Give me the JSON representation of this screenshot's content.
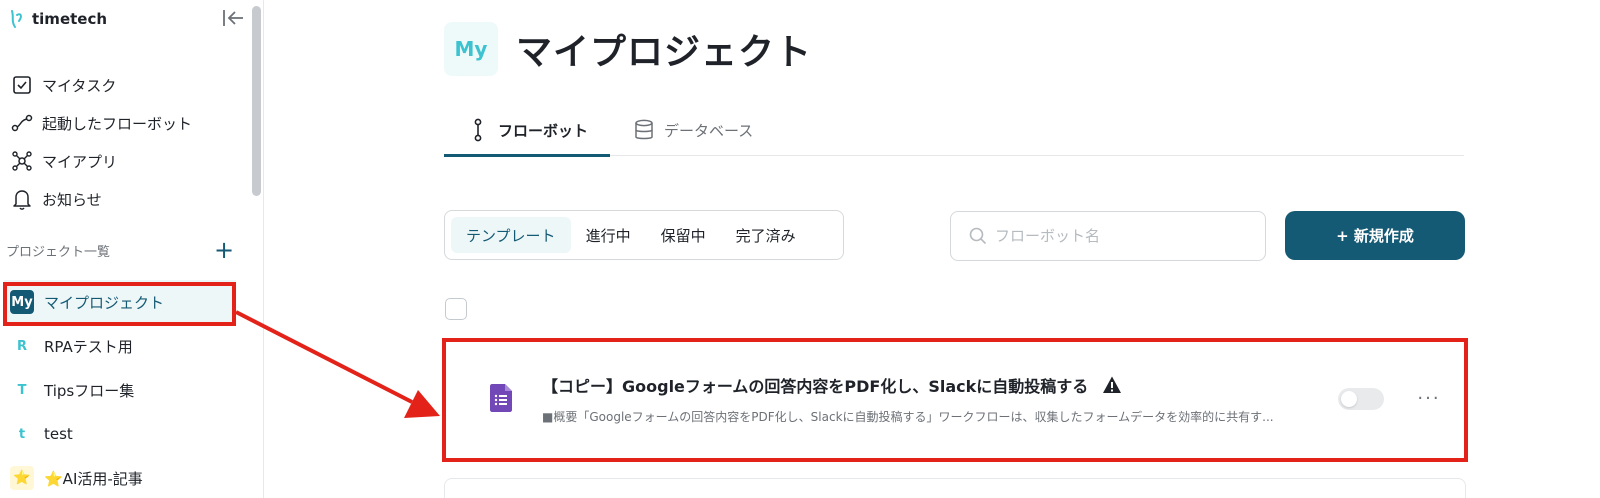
{
  "sidebar": {
    "brand": "timetech",
    "nav": [
      {
        "label": "マイタスク",
        "icon": "check-square-icon"
      },
      {
        "label": "起動したフローボット",
        "icon": "flow-path-icon"
      },
      {
        "label": "マイアプリ",
        "icon": "app-network-icon"
      },
      {
        "label": "お知らせ",
        "icon": "bell-icon"
      }
    ],
    "projects_header": "プロジェクト一覧",
    "projects_add": "+",
    "projects": [
      {
        "badge": "My",
        "label": "マイプロジェクト",
        "active": true
      },
      {
        "badge": "R",
        "label": "RPAテスト用"
      },
      {
        "badge": "T",
        "label": "Tipsフロー集"
      },
      {
        "badge": "t",
        "label": "test"
      },
      {
        "badge": "⭐",
        "label": "⭐AI活用-記事"
      }
    ]
  },
  "header": {
    "badge": "My",
    "title": "マイプロジェクト"
  },
  "tabs": [
    {
      "label": "フローボット",
      "icon": "flowbot-icon",
      "active": true
    },
    {
      "label": "データベース",
      "icon": "database-icon",
      "active": false
    }
  ],
  "filters": [
    "テンプレート",
    "進行中",
    "保留中",
    "完了済み"
  ],
  "search": {
    "placeholder": "フローボット名"
  },
  "new_button": "+ 新規作成",
  "flowbots": [
    {
      "title": "【コピー】Googleフォームの回答内容をPDF化し、Slackに自動投稿する",
      "description": "■概要「Googleフォームの回答内容をPDF化し、Slackに自動投稿する」ワークフローは、収集したフォームデータを効率的に共有す...",
      "app_icon": "google-forms-icon",
      "warning": true,
      "enabled": false,
      "more_label": "···"
    }
  ],
  "colors": {
    "accent": "#155a74",
    "highlight": "#e32219",
    "teal": "#3cc3cf",
    "forms": "#7248b9"
  }
}
